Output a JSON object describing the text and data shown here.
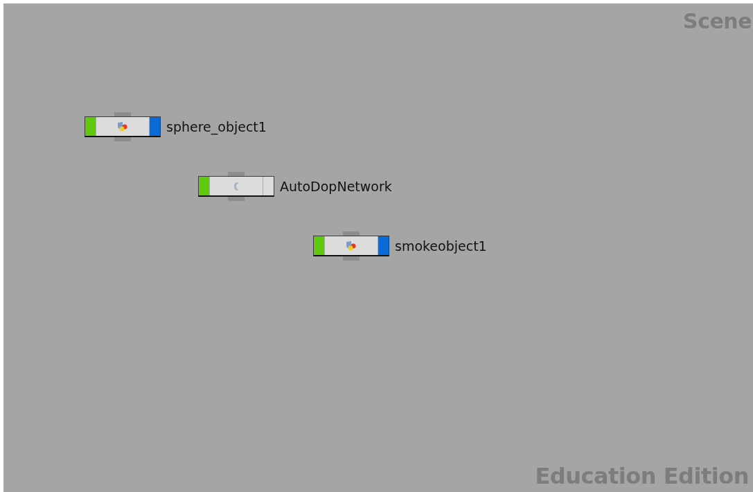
{
  "network_view": {
    "title": "Scene",
    "edition": "Education Edition"
  },
  "nodes": [
    {
      "label": "sphere_object1",
      "kind": "object",
      "display": true,
      "render": true
    },
    {
      "label": "AutoDopNetwork",
      "kind": "dop",
      "display": true,
      "render": false
    },
    {
      "label": "smokeobject1",
      "kind": "object",
      "display": true,
      "render": true
    }
  ]
}
